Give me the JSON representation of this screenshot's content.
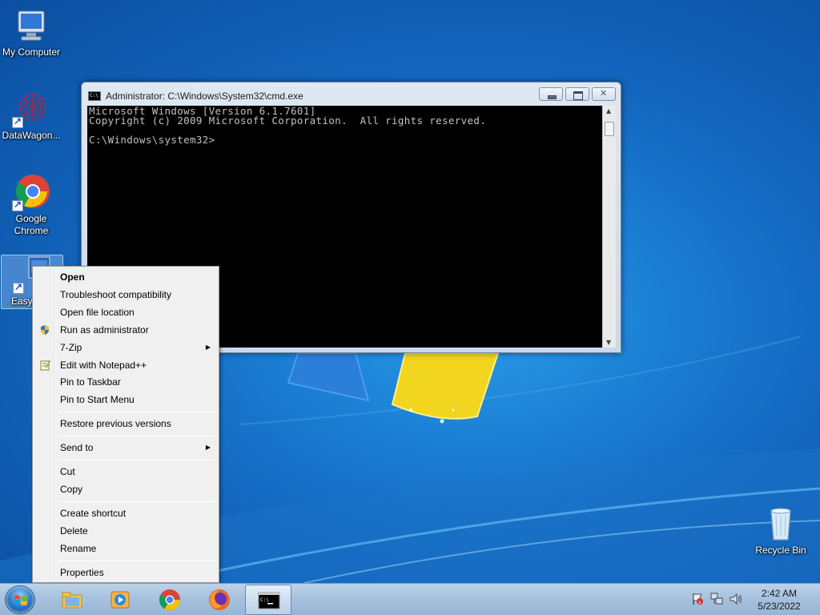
{
  "desktop": {
    "icons": [
      {
        "label": "My Computer"
      },
      {
        "label": "DataWagon..."
      },
      {
        "label": "Google Chrome"
      },
      {
        "label": "EasyBCD"
      },
      {
        "label": "Recycle Bin"
      }
    ]
  },
  "cmd_window": {
    "title": "Administrator: C:\\Windows\\System32\\cmd.exe",
    "lines": [
      "Microsoft Windows [Version 6.1.7601]",
      "Copyright (c) 2009 Microsoft Corporation.  All rights reserved.",
      "",
      "C:\\Windows\\system32>"
    ]
  },
  "context_menu": {
    "items": [
      {
        "label": "Open"
      },
      {
        "label": "Troubleshoot compatibility"
      },
      {
        "label": "Open file location"
      },
      {
        "label": "Run as administrator",
        "icon": "shield-icon"
      },
      {
        "label": "7-Zip",
        "submenu": true
      },
      {
        "label": "Edit with Notepad++",
        "icon": "notepad-plus-plus-icon"
      },
      {
        "label": "Pin to Taskbar"
      },
      {
        "label": "Pin to Start Menu"
      },
      {
        "label": "Restore previous versions"
      },
      {
        "label": "Send to",
        "submenu": true
      },
      {
        "label": "Cut"
      },
      {
        "label": "Copy"
      },
      {
        "label": "Create shortcut"
      },
      {
        "label": "Delete"
      },
      {
        "label": "Rename"
      },
      {
        "label": "Properties"
      }
    ]
  },
  "taskbar": {
    "pinned": [
      "explorer-icon",
      "media-player-icon",
      "chrome-icon",
      "firefox-icon",
      "cmd-icon"
    ],
    "active": "cmd-icon",
    "clock": {
      "time": "2:42 AM",
      "date": "5/23/2022"
    }
  },
  "colors": {
    "desktop_bg": "#1b7fd4",
    "cmd_bg": "#000000",
    "cmd_text": "#c0c0c0",
    "menu_bg": "#f0f0f0"
  }
}
